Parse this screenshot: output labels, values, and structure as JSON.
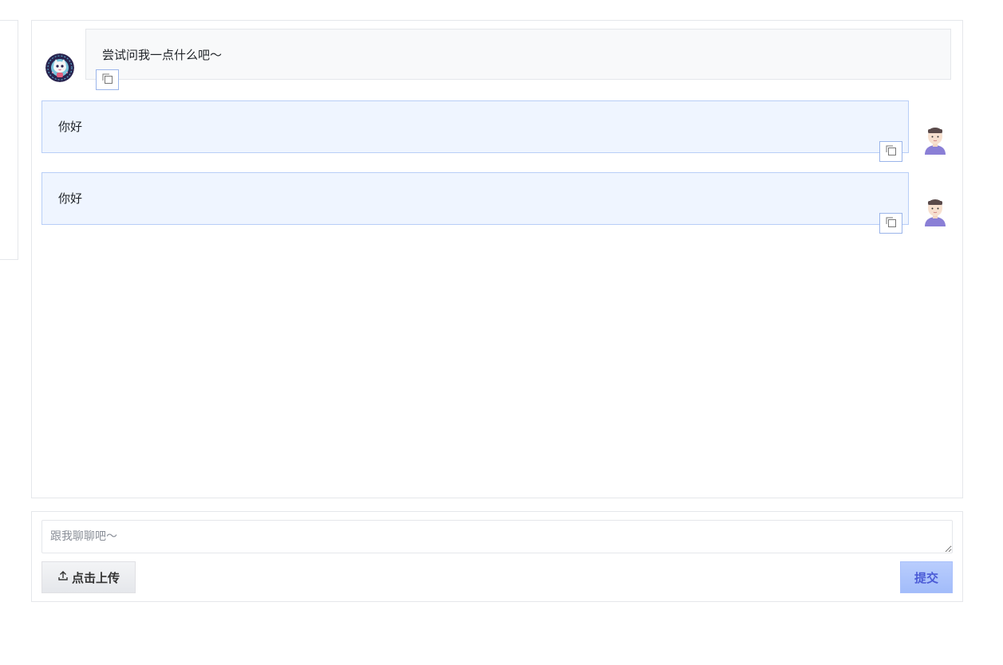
{
  "messages": [
    {
      "role": "bot",
      "text": "尝试问我一点什么吧～",
      "avatar_icon": "cartoon-cat-avatar-icon"
    },
    {
      "role": "user",
      "text": "你好",
      "avatar_icon": "user-avatar-icon"
    },
    {
      "role": "user",
      "text": "你好",
      "avatar_icon": "user-avatar-icon"
    }
  ],
  "input": {
    "placeholder": "跟我聊聊吧～",
    "value": ""
  },
  "buttons": {
    "upload_label": "点击上传",
    "submit_label": "提交",
    "copy_icon": "copy-icon"
  },
  "colors": {
    "user_bubble_bg": "#eff5ff",
    "user_bubble_border": "#b8cef7",
    "bot_bubble_bg": "#f8f9fa",
    "submit_bg": "#a2bcfa",
    "submit_text": "#4b5bd6"
  }
}
